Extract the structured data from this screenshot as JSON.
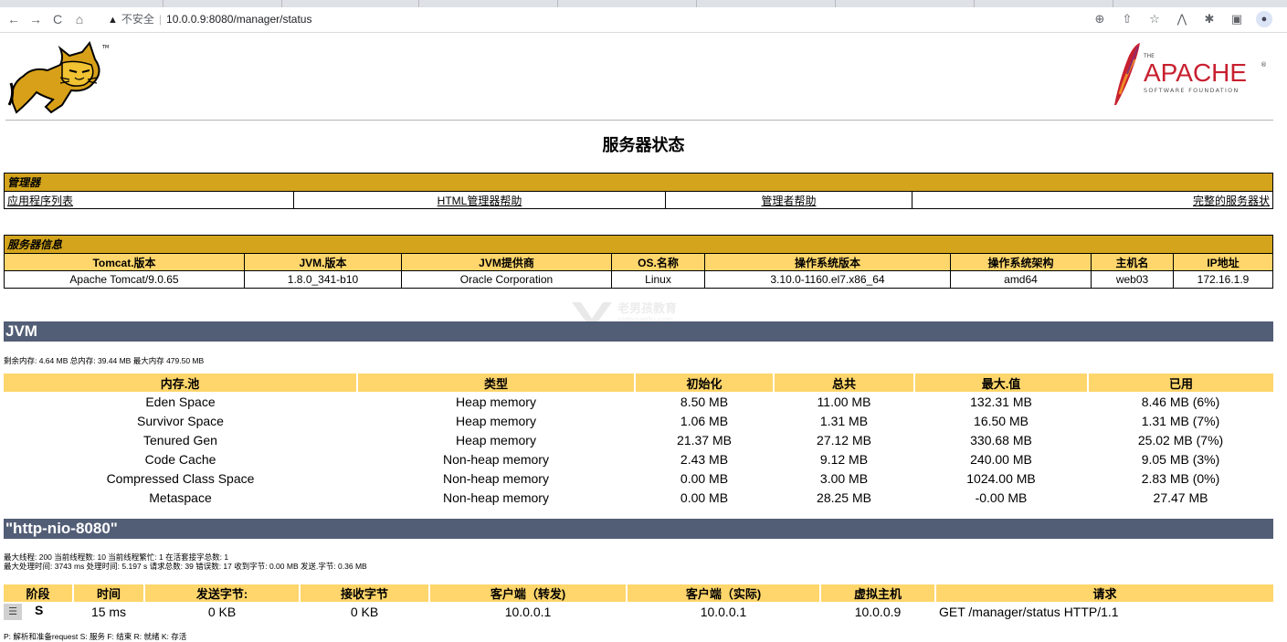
{
  "browser": {
    "url_prefix": "不安全",
    "url": "10.0.0.9:8080/manager/status",
    "warning_icon": "warning-triangle-icon",
    "nav": {
      "back": "←",
      "forward": "→",
      "reload": "C",
      "home": "⌂"
    }
  },
  "header": {
    "title": "服务器状态",
    "apache_small": "THE",
    "apache_big": "APACHE",
    "apache_sub": "SOFTWARE FOUNDATION",
    "apache_tm": "®"
  },
  "manager": {
    "section": "管理器",
    "links": [
      "应用程序列表",
      "HTML管理器帮助",
      "管理者帮助",
      "完整的服务器状"
    ]
  },
  "server_info": {
    "section": "服务器信息",
    "headers": [
      "Tomcat.版本",
      "JVM.版本",
      "JVM提供商",
      "OS.名称",
      "操作系统版本",
      "操作系统架构",
      "主机名",
      "IP地址"
    ],
    "values": [
      "Apache Tomcat/9.0.65",
      "1.8.0_341-b10",
      "Oracle Corporation",
      "Linux",
      "3.10.0-1160.el7.x86_64",
      "amd64",
      "web03",
      "172.16.1.9"
    ]
  },
  "jvm": {
    "title": "JVM",
    "summary": "剩余内存:  4.64 MB 总内存:  39.44 MB 最大内存 479.50 MB",
    "headers": [
      "内存.池",
      "类型",
      "初始化",
      "总共",
      "最大.值",
      "已用"
    ],
    "rows": [
      [
        "Eden Space",
        "Heap memory",
        "8.50 MB",
        "11.00 MB",
        "132.31 MB",
        "8.46 MB (6%)"
      ],
      [
        "Survivor Space",
        "Heap memory",
        "1.06 MB",
        "1.31 MB",
        "16.50 MB",
        "1.31 MB (7%)"
      ],
      [
        "Tenured Gen",
        "Heap memory",
        "21.37 MB",
        "27.12 MB",
        "330.68 MB",
        "25.02 MB (7%)"
      ],
      [
        "Code Cache",
        "Non-heap memory",
        "2.43 MB",
        "9.12 MB",
        "240.00 MB",
        "9.05 MB (3%)"
      ],
      [
        "Compressed Class Space",
        "Non-heap memory",
        "0.00 MB",
        "3.00 MB",
        "1024.00 MB",
        "2.83 MB (0%)"
      ],
      [
        "Metaspace",
        "Non-heap memory",
        "0.00 MB",
        "28.25 MB",
        "-0.00 MB",
        "27.47 MB"
      ]
    ]
  },
  "connector": {
    "title": "\"http-nio-8080\"",
    "line1": "最大线程:  200 当前线程数:  10 当前线程繁忙:  1 在活套接字总数:  1",
    "line2": "最大处理时间:  3743 ms 处理时间:  5.197 s 请求总数:  39 错误数:  17 收到字节:  0.00 MB 发送.字节: 0.36 MB",
    "headers": [
      "阶段",
      "时间",
      "发送字节:",
      "接收字节",
      "客户端（转发)",
      "客户端（实际)",
      "虚拟主机",
      "请求"
    ],
    "row": {
      "stage": "S",
      "time": "15 ms",
      "sent": "0 KB",
      "recv": "0 KB",
      "client_fwd": "10.0.0.1",
      "client_real": "10.0.0.1",
      "vhost": "10.0.0.9",
      "request": "GET /manager/status HTTP/1.1"
    },
    "legend": "P: 解析和准备request S: 服务 F: 结束 R: 就绪 K: 存活"
  },
  "watermark": {
    "text": "老男孩教育",
    "sub": "oldboyedu.com"
  }
}
